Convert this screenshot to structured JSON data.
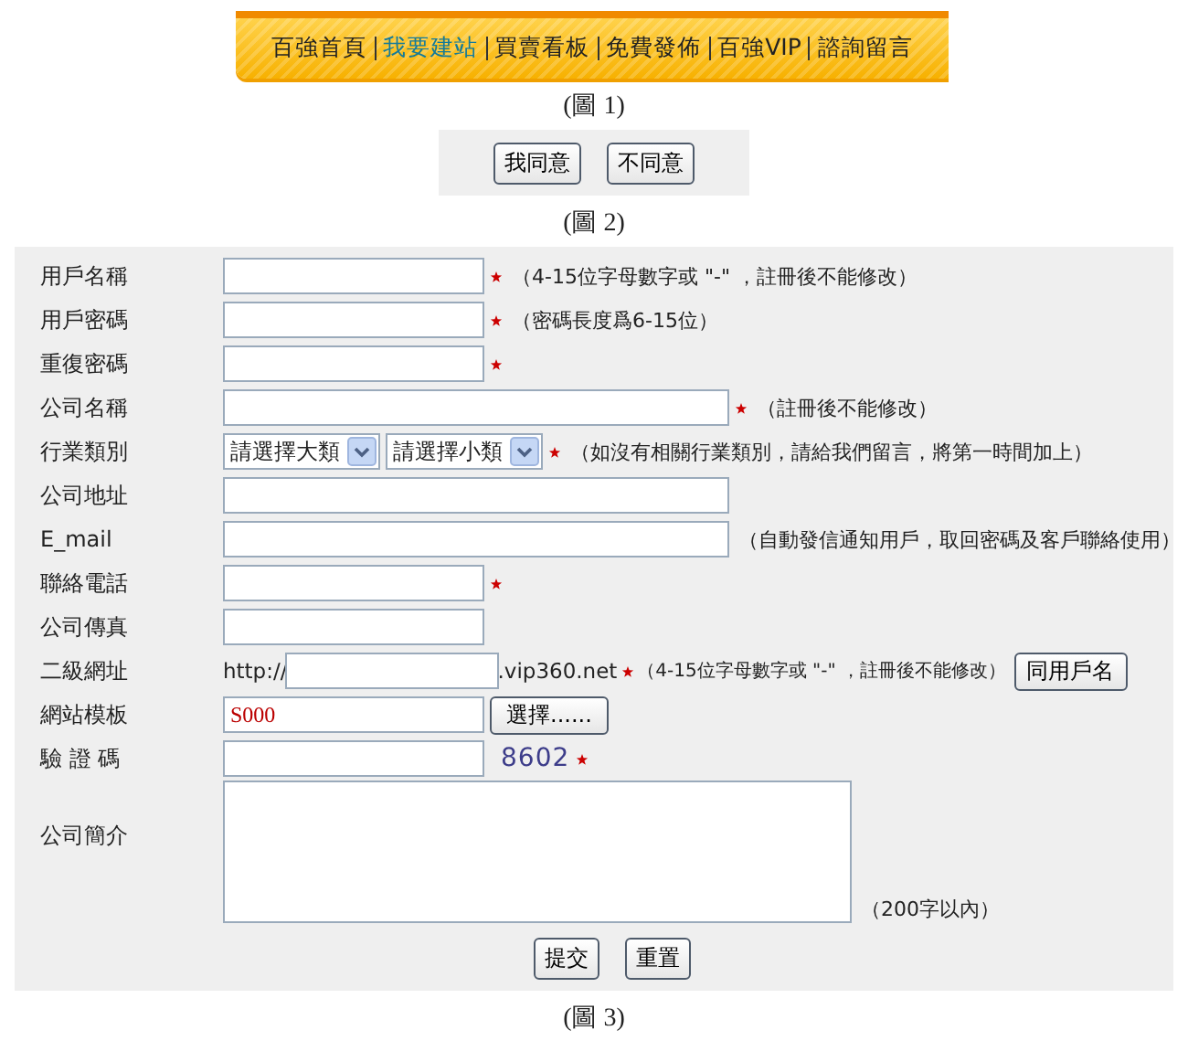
{
  "nav": {
    "items": [
      {
        "label": "百強首頁",
        "selected": false
      },
      {
        "label": "我要建站",
        "selected": true
      },
      {
        "label": "買賣看板",
        "selected": false
      },
      {
        "label": "免費發佈",
        "selected": false
      },
      {
        "label": "百強VIP",
        "selected": false
      },
      {
        "label": "諮詢留言",
        "selected": false
      }
    ]
  },
  "captions": [
    "(圖 1)",
    "(圖 2)",
    "(圖 3)"
  ],
  "agreement_buttons": [
    "我同意",
    "不同意"
  ],
  "form": {
    "rows": [
      {
        "kind": "text",
        "label": "用戶名稱",
        "wide": false,
        "required": true,
        "note": "（4-15位字母數字或 \"-\" ，註冊後不能修改）"
      },
      {
        "kind": "text",
        "label": "用戶密碼",
        "wide": false,
        "required": true,
        "note": "（密碼長度爲6-15位）"
      },
      {
        "kind": "text",
        "label": "重復密碼",
        "wide": false,
        "required": true
      },
      {
        "kind": "text",
        "label": "公司名稱",
        "wide": true,
        "required": true,
        "note": "（註冊後不能修改）"
      },
      {
        "kind": "select",
        "label": "行業類別",
        "selects": [
          "請選擇大類",
          "請選擇小類"
        ],
        "required": true,
        "note": "（如沒有相關行業類別，請給我們留言，將第一時間加上）"
      },
      {
        "kind": "text",
        "label": "公司地址",
        "wide": true,
        "required": false
      },
      {
        "kind": "text",
        "label": "E_mail",
        "wide": true,
        "required": false,
        "note": "（自動發信通知用戶，取回密碼及客戶聯絡使用）"
      },
      {
        "kind": "text",
        "label": "聯絡電話",
        "wide": false,
        "required": true
      },
      {
        "kind": "text",
        "label": "公司傳真",
        "wide": false,
        "required": false
      },
      {
        "kind": "url",
        "label": "二級網址",
        "prefix": "http://",
        "suffix": ".vip360.net",
        "required": true,
        "note": "（4-15位字母數字或 \"-\" ，註冊後不能修改）",
        "button": "同用戶名"
      },
      {
        "kind": "template",
        "label": "網站模板",
        "value": "S000",
        "button": "選擇......"
      },
      {
        "kind": "captcha",
        "label": "驗 證 碼",
        "code": "8602",
        "required": true
      },
      {
        "kind": "textarea",
        "label": "公司簡介",
        "note": "（200字以內）"
      }
    ],
    "buttons": [
      "提交",
      "重置"
    ]
  }
}
